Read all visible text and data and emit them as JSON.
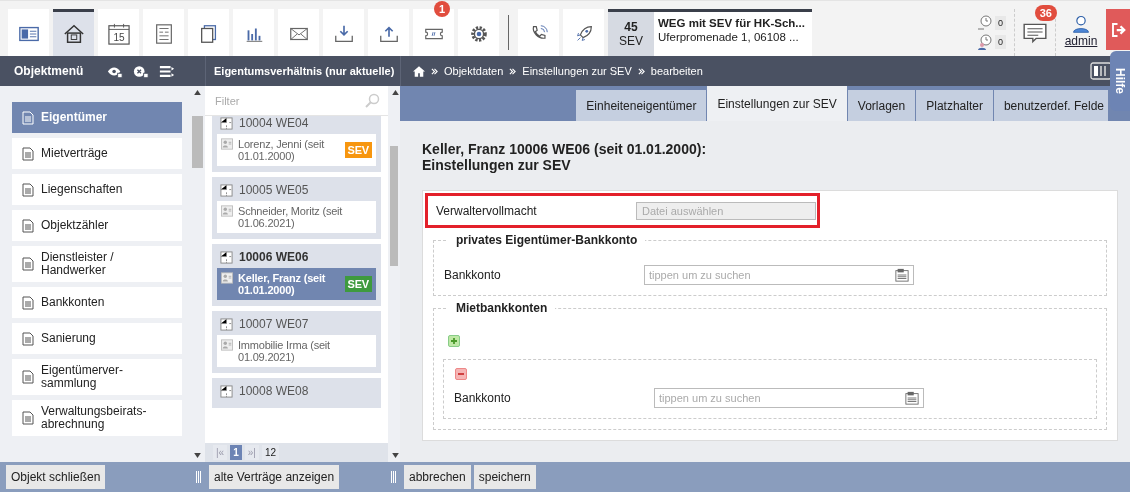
{
  "toolbar": [
    {
      "kind": "card",
      "selected": false
    },
    {
      "kind": "home",
      "selected": true
    },
    {
      "kind": "calendar",
      "selected": false,
      "text": "15"
    },
    {
      "kind": "form",
      "selected": false
    },
    {
      "kind": "copy",
      "selected": false
    },
    {
      "kind": "chart",
      "selected": false
    },
    {
      "kind": "mail",
      "selected": false
    },
    {
      "kind": "download",
      "selected": false
    },
    {
      "kind": "upload",
      "selected": false
    },
    {
      "kind": "ticket",
      "selected": false,
      "badge": "1"
    },
    {
      "kind": "gear",
      "selected": false
    },
    {
      "kind": "divider"
    },
    {
      "kind": "phone",
      "selected": false
    },
    {
      "kind": "rocket",
      "selected": false
    }
  ],
  "object": {
    "count": "45",
    "type": "SEV",
    "title": "WEG mit SEV für HK-Sch...",
    "address": "Uferpromenade 1, 06108 ..."
  },
  "counters": [
    {
      "kind": "clock",
      "value": "0"
    },
    {
      "kind": "person",
      "value": "0"
    }
  ],
  "messages": {
    "badge": "36"
  },
  "user": {
    "name": "admin"
  },
  "nav": {
    "menu_title": "Objektmenü",
    "panel_title": "Eigentumsverhältnis (nur aktuelle)",
    "breadcrumb": [
      "Objektdaten",
      "Einstellungen zur SEV",
      "bearbeiten"
    ]
  },
  "sidebar": [
    {
      "label": "Eigentümer",
      "selected": true
    },
    {
      "label": "Mietverträge",
      "selected": false
    },
    {
      "label": "Liegenschaften",
      "selected": false
    },
    {
      "label": "Objektzähler",
      "selected": false
    },
    {
      "label": "Dienstleister / Handwerker",
      "selected": false
    },
    {
      "label": "Bankkonten",
      "selected": false
    },
    {
      "label": "Sanierung",
      "selected": false
    },
    {
      "label": "Eigentümerver-sammlung",
      "selected": false
    },
    {
      "label": "Verwaltungsbeirats-abrechnung",
      "selected": false
    }
  ],
  "filter": {
    "placeholder": "Filter"
  },
  "units": [
    {
      "number": "10004 WE04",
      "selected": false,
      "owner": "Lorenz, Jenni (seit 01.01.2000)",
      "tag": "SEV",
      "color": "#f7960f"
    },
    {
      "number": "10005 WE05",
      "selected": false,
      "owner": "Schneider, Moritz (seit 01.06.2021)"
    },
    {
      "number": "10006 WE06",
      "selected": true,
      "owner": "Keller, Franz (seit 01.01.2000)",
      "tag": "SEV",
      "color": "#3e9a3e"
    },
    {
      "number": "10007 WE07",
      "selected": false,
      "owner": "Immobilie Irma (seit 01.09.2021)"
    },
    {
      "number": "10008 WE08",
      "selected": false
    }
  ],
  "pager": {
    "first": "|«",
    "current": "1",
    "last": "»|",
    "total": "12"
  },
  "tabs": [
    {
      "label": "Einheiteneigentümer",
      "selected": false
    },
    {
      "label": "Einstellungen zur SEV",
      "selected": true
    },
    {
      "label": "Vorlagen",
      "selected": false
    },
    {
      "label": "Platzhalter",
      "selected": false
    },
    {
      "label": "benutzerdef. Felde",
      "selected": false
    }
  ],
  "help": "Hilfe",
  "heading": [
    "Keller, Franz 10006 WE06 (seit 01.01.2000):",
    "Einstellungen zur SEV"
  ],
  "proxy": {
    "label": "Verwaltervollmacht",
    "placeholder": "Datei auswählen",
    "highlighted": true
  },
  "private_account": {
    "legend": "privates Eigentümer-Bankkonto",
    "label": "Bankkonto",
    "placeholder": "tippen um zu suchen"
  },
  "rental_accounts": {
    "legend": "Mietbankkonten",
    "entries": [
      {
        "label": "Bankkonto",
        "placeholder": "tippen um zu suchen"
      }
    ]
  },
  "footer": {
    "left": "Objekt schließen",
    "middle": "alte Verträge anzeigen",
    "right": [
      "abbrechen",
      "speichern"
    ]
  }
}
